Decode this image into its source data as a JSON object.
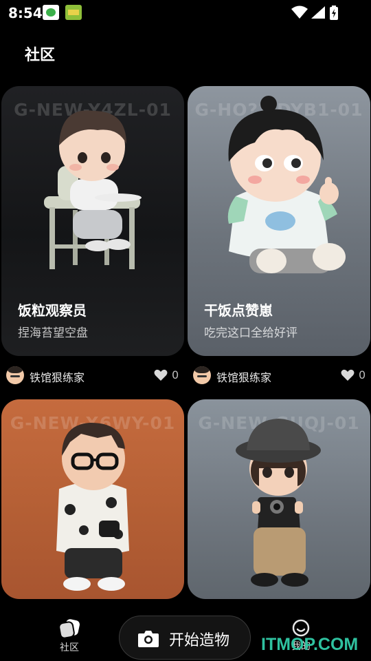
{
  "status_bar": {
    "time": "8:54"
  },
  "page_title": "社区",
  "cards": [
    {
      "code": "G-NEW-Y4ZL-01",
      "title": "饭粒观察员",
      "subtitle": "捏海苔望空盘",
      "author": "铁馆狠练家",
      "likes": "0",
      "background": "#1a1b1d"
    },
    {
      "code": "G-HO??-DYB1-01",
      "title": "干饭点赞崽",
      "subtitle": "吃完这口全给好评",
      "author": "铁馆狠练家",
      "likes": "0",
      "background": "#7a8189"
    },
    {
      "code": "G-NEW-X6WY-01",
      "title": "",
      "subtitle": "",
      "author": "",
      "likes": "",
      "background": "#b35e34"
    },
    {
      "code": "G-NEW-GUQJ-01",
      "title": "",
      "subtitle": "",
      "author": "",
      "likes": "",
      "background": "#737a82"
    }
  ],
  "bottom_nav": {
    "community_label": "社区",
    "create_label": "开始造物",
    "mine_label": "我的"
  },
  "site_watermark": "ITMOP.COM",
  "icons": [
    "wifi-icon",
    "signal-icon",
    "battery-icon",
    "heart-icon",
    "camera-icon",
    "community-icon",
    "smiley-icon"
  ]
}
